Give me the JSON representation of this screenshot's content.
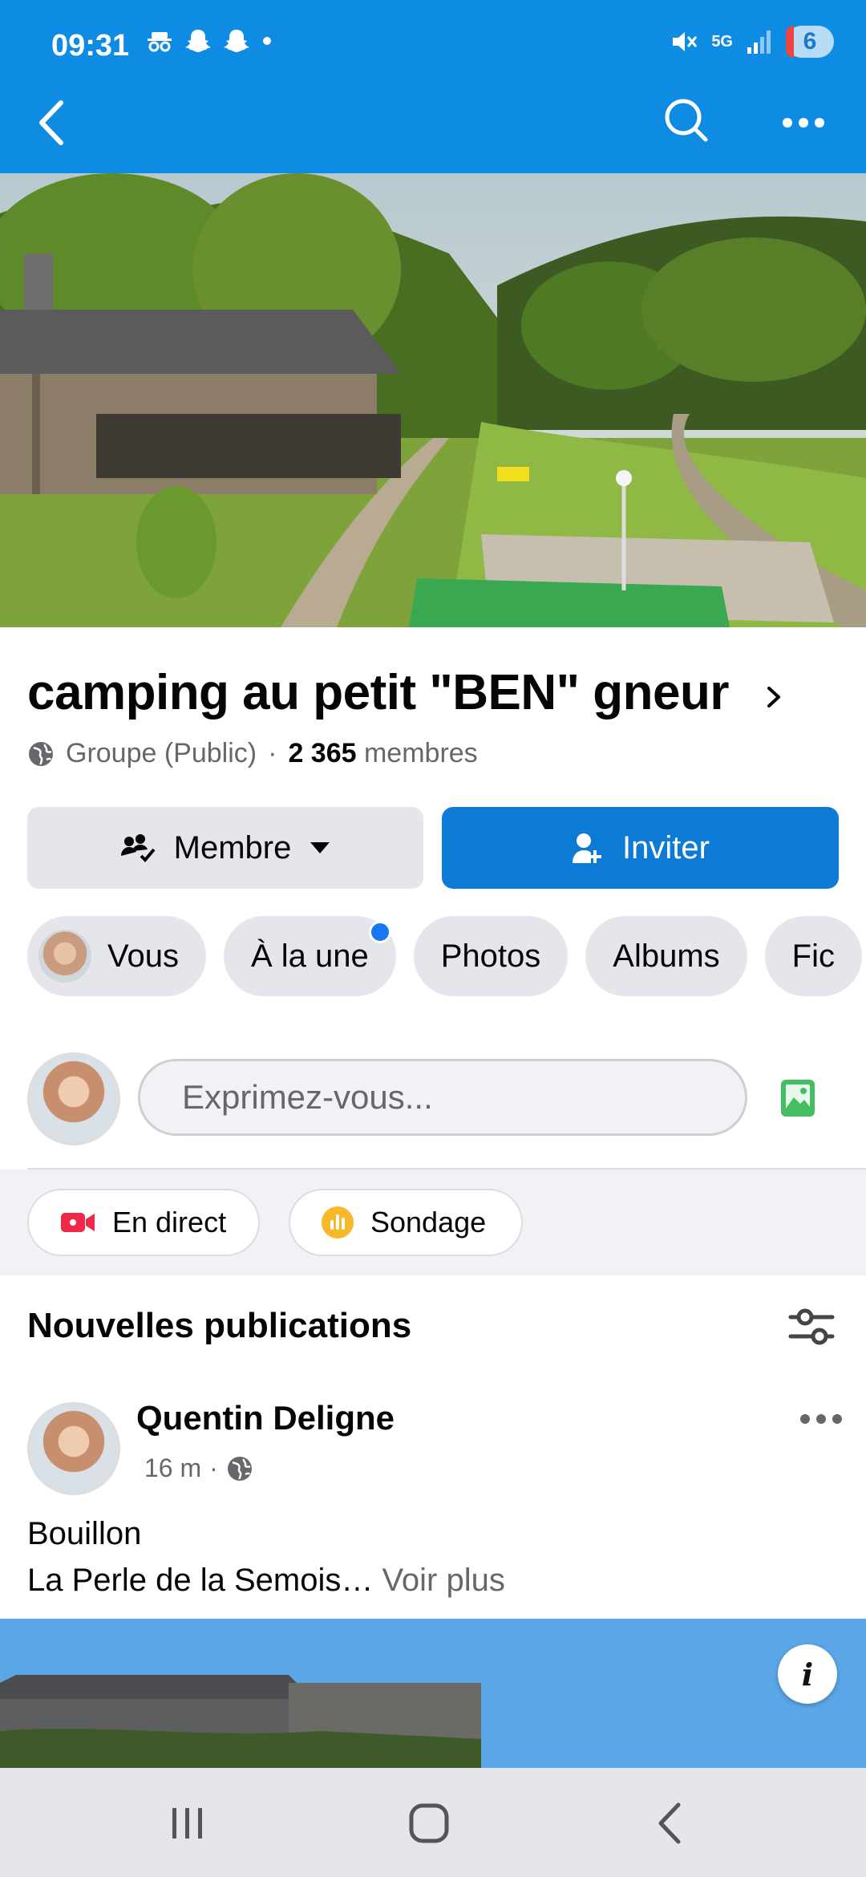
{
  "status_bar": {
    "time": "09:31",
    "network": "5G",
    "battery": "6"
  },
  "group": {
    "name": "camping au petit \"BEN\" gneur",
    "privacy": "Groupe (Public)",
    "separator": "·",
    "member_count": "2 365",
    "members_label": "membres"
  },
  "actions": {
    "member_label": "Membre",
    "invite_label": "Inviter"
  },
  "tabs": [
    {
      "label": "Vous"
    },
    {
      "label": "À la une"
    },
    {
      "label": "Photos"
    },
    {
      "label": "Albums"
    },
    {
      "label": "Fic"
    }
  ],
  "composer": {
    "placeholder": "Exprimez-vous..."
  },
  "chips": {
    "live": "En direct",
    "poll": "Sondage"
  },
  "feed": {
    "title": "Nouvelles publications"
  },
  "post": {
    "author": "Quentin Deligne",
    "time": "16 m",
    "separator": "·",
    "line1": "Bouillon",
    "line2": "La Perle de la Semois…",
    "see_more": "Voir plus"
  },
  "info_label": "i",
  "colors": {
    "header": "#0e8ce4",
    "primary_button": "#0d7ad6",
    "notification_dot": "#1877f2"
  },
  "icons": [
    "back-arrow-icon",
    "search-icon",
    "more-icon",
    "globe-icon",
    "members-icon",
    "caret-down-icon",
    "add-person-icon",
    "photo-icon",
    "live-video-icon",
    "poll-icon",
    "filter-icon"
  ]
}
